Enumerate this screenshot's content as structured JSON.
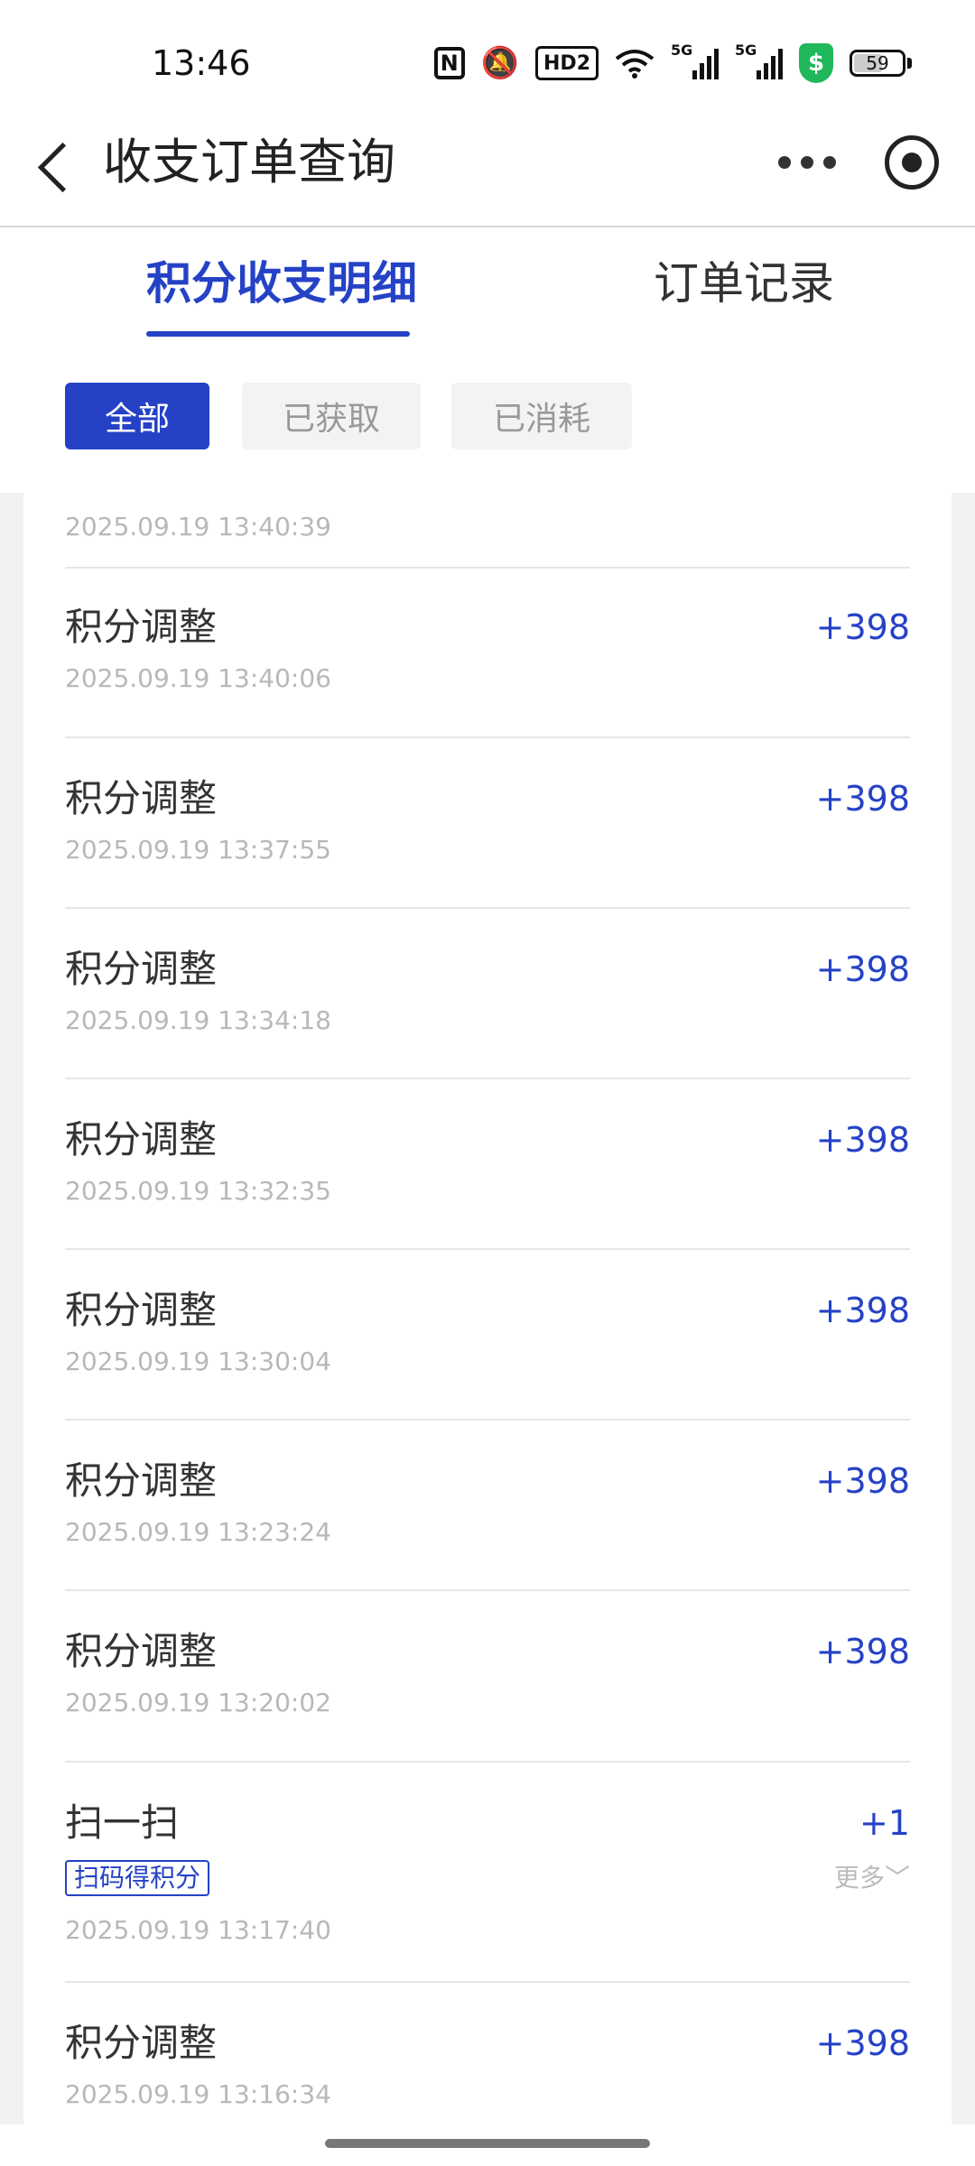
{
  "status_bar": {
    "time": "13:46",
    "battery": "59",
    "signal_label_1": "5G",
    "signal_label_2": "5G",
    "hd_label": "HD2",
    "icons": [
      "nfc-icon",
      "mute-icon",
      "hd-icon",
      "wifi-icon",
      "signal-icon",
      "signal-icon",
      "shield-icon",
      "battery-icon"
    ]
  },
  "nav": {
    "title": "收支订单查询",
    "icons": [
      "back-icon",
      "more-icon",
      "record-icon"
    ]
  },
  "tabs": [
    {
      "label": "积分收支明细",
      "active": true
    },
    {
      "label": "订单记录",
      "active": false
    }
  ],
  "filters": [
    {
      "label": "全部",
      "active": true
    },
    {
      "label": "已获取",
      "active": false
    },
    {
      "label": "已消耗",
      "active": false
    }
  ],
  "list": {
    "partial_top_time": "2025.09.19 13:40:39",
    "items": [
      {
        "title": "积分调整",
        "amount": "+398",
        "time": "2025.09.19 13:40:06"
      },
      {
        "title": "积分调整",
        "amount": "+398",
        "time": "2025.09.19 13:37:55"
      },
      {
        "title": "积分调整",
        "amount": "+398",
        "time": "2025.09.19 13:34:18"
      },
      {
        "title": "积分调整",
        "amount": "+398",
        "time": "2025.09.19 13:32:35"
      },
      {
        "title": "积分调整",
        "amount": "+398",
        "time": "2025.09.19 13:30:04"
      },
      {
        "title": "积分调整",
        "amount": "+398",
        "time": "2025.09.19 13:23:24"
      },
      {
        "title": "积分调整",
        "amount": "+398",
        "time": "2025.09.19 13:20:02"
      },
      {
        "title": "扫一扫",
        "amount": "+1",
        "tag": "扫码得积分",
        "more": "更多﹀",
        "time": "2025.09.19 13:17:40"
      },
      {
        "title": "积分调整",
        "amount": "+398",
        "time": "2025.09.19 13:16:34"
      }
    ]
  },
  "colors": {
    "accent": "#2542c6",
    "secure_green": "#1fb85a"
  }
}
